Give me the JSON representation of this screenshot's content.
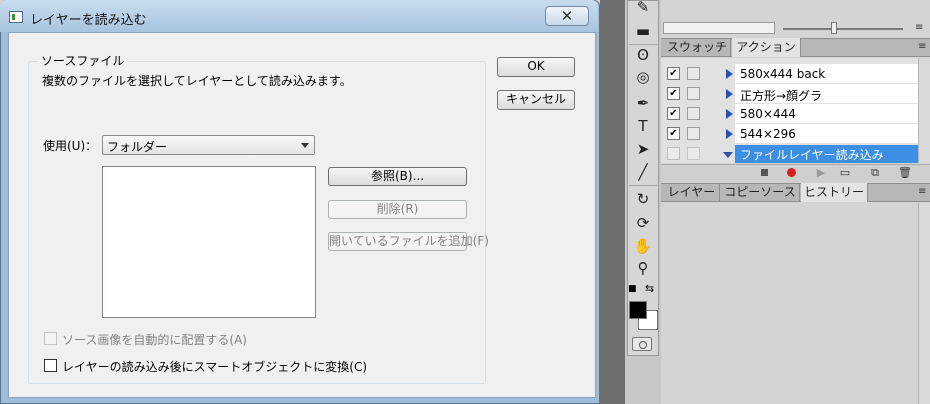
{
  "dialog": {
    "title": "レイヤーを読み込む",
    "close_label": "✕",
    "group_label": "ソースファイル",
    "description": "複数のファイルを選択してレイヤーとして読み込みます。",
    "use_label": "使用(U)：",
    "use_value": "フォルダー",
    "browse_label": "参照(B)...",
    "remove_label": "削除(R)",
    "add_open_label": "開いているファイルを追加(F)",
    "ok_label": "OK",
    "cancel_label": "キャンセル",
    "auto_align_label": "ソース画像を自動的に配置する(A)",
    "auto_align_checked": false,
    "auto_align_enabled": false,
    "smart_object_label": "レイヤーの読み込み後にスマートオブジェクトに変換(C)",
    "smart_object_checked": false
  },
  "panels": {
    "tabs_top": [
      "スウォッチ",
      "アクション"
    ],
    "active_top": "アクション",
    "actions": [
      {
        "name": "580x444 back",
        "checked": true
      },
      {
        "name": "正方形→顔グラ",
        "checked": true
      },
      {
        "name": "580×444",
        "checked": true
      },
      {
        "name": "544×296",
        "checked": true
      }
    ],
    "selected_action": "ファイルレイヤー読み込み",
    "tabs_bottom": [
      "レイヤー",
      "コピーソース",
      "ヒストリー"
    ],
    "active_bottom": "ヒストリー",
    "check_mark": "✔",
    "menu_icon": "≡"
  },
  "tools": [
    "eraser-icon",
    "rectangle-icon",
    "lasso-icon",
    "quick-selection-icon",
    "pen-icon",
    "text-icon",
    "path-selection-icon",
    "line-icon",
    "rotate-3d-icon",
    "orbit-3d-icon",
    "hand-icon",
    "zoom-icon"
  ],
  "colors": {
    "foreground": "#000000",
    "background": "#ffffff",
    "selection": "#3d8fe6",
    "record": "#d52020"
  }
}
